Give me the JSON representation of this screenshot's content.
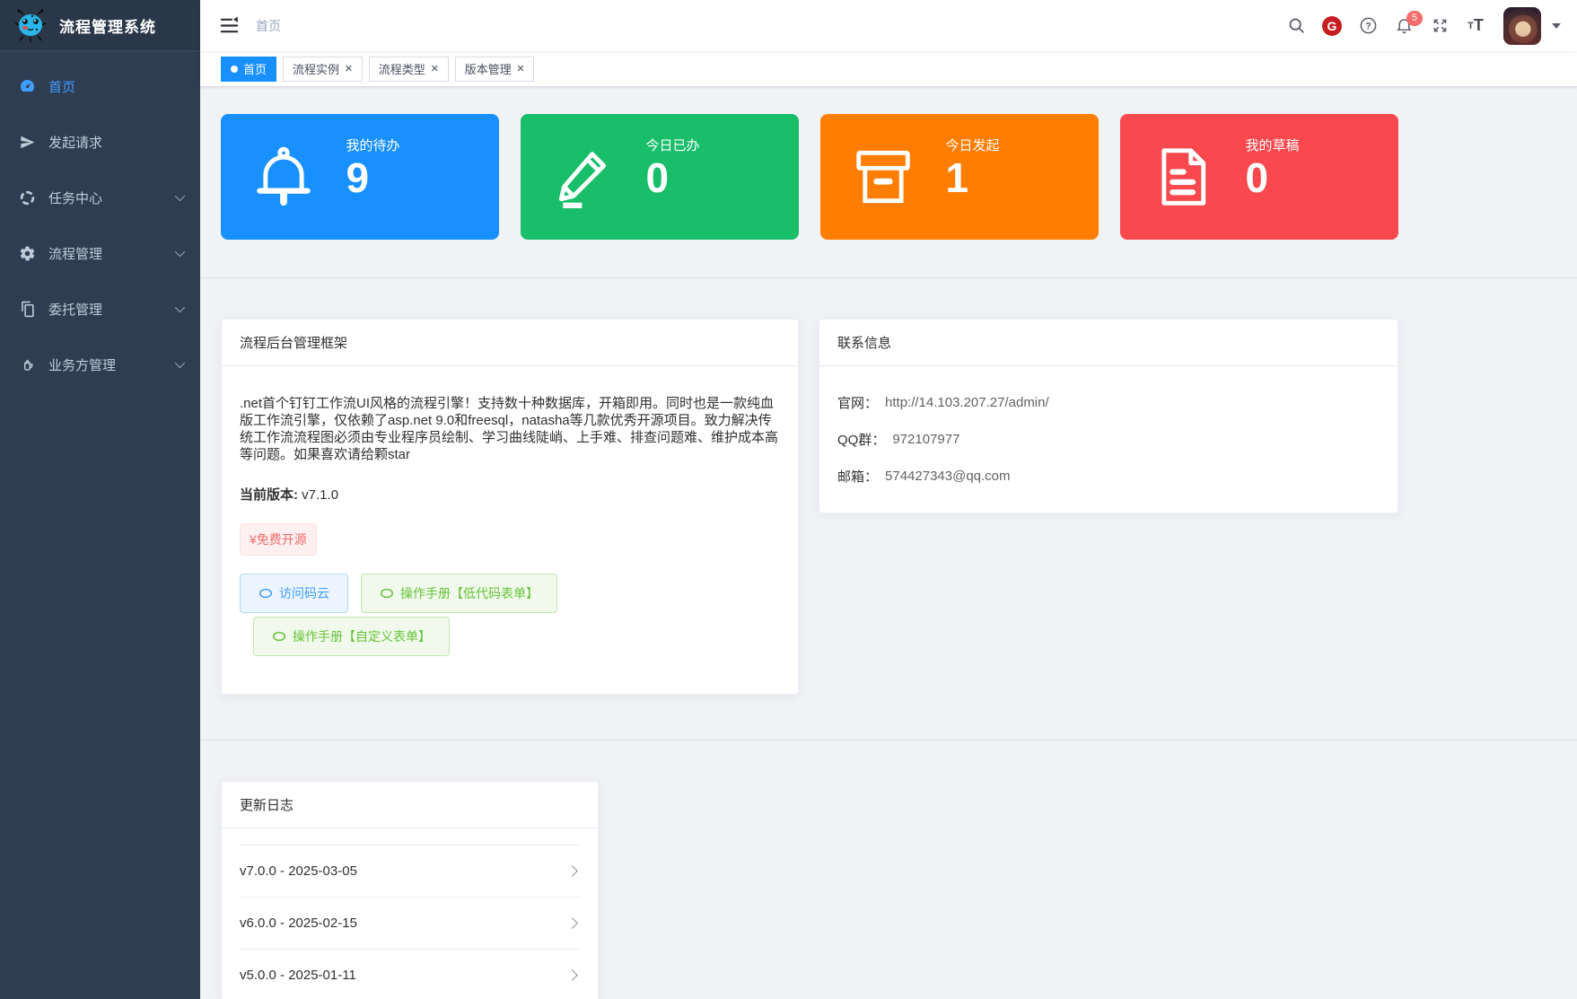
{
  "app": {
    "title": "流程管理系统",
    "logo_icon": "bug-mascot-icon"
  },
  "colors": {
    "primary": "#1890ff",
    "sidebar_bg": "#2f3d52",
    "danger_badge": "#f56c6c",
    "gitee_red": "#c71d23"
  },
  "sidebar": {
    "items": [
      {
        "label": "首页",
        "icon": "dashboard-icon",
        "active": true,
        "has_children": false
      },
      {
        "label": "发起请求",
        "icon": "send-icon",
        "active": false,
        "has_children": false
      },
      {
        "label": "任务中心",
        "icon": "task-ring-icon",
        "active": false,
        "has_children": true
      },
      {
        "label": "流程管理",
        "icon": "gear-icon",
        "active": false,
        "has_children": true
      },
      {
        "label": "委托管理",
        "icon": "copy-icon",
        "active": false,
        "has_children": true
      },
      {
        "label": "业务方管理",
        "icon": "teapot-icon",
        "active": false,
        "has_children": true
      }
    ]
  },
  "header": {
    "breadcrumb": "首页",
    "notification_count": "5",
    "icons": [
      "collapse-menu-icon",
      "search-icon",
      "gitee-icon",
      "help-icon",
      "bell-icon",
      "fullscreen-icon",
      "font-size-icon",
      "avatar",
      "caret-down-icon"
    ]
  },
  "tabs": [
    {
      "label": "首页",
      "active": true,
      "closable": false
    },
    {
      "label": "流程实例",
      "active": false,
      "closable": true
    },
    {
      "label": "流程类型",
      "active": false,
      "closable": true
    },
    {
      "label": "版本管理",
      "active": false,
      "closable": true
    }
  ],
  "stats": [
    {
      "label": "我的待办",
      "value": "9",
      "color": "#1890ff",
      "icon": "bell-outline-icon"
    },
    {
      "label": "今日已办",
      "value": "0",
      "color": "#19be6b",
      "icon": "pencil-icon"
    },
    {
      "label": "今日发起",
      "value": "1",
      "color": "#ff7d00",
      "icon": "archive-box-icon"
    },
    {
      "label": "我的草稿",
      "value": "0",
      "color": "#f9484e",
      "icon": "draft-document-icon"
    }
  ],
  "intro_card": {
    "title": "流程后台管理框架",
    "description": ".net首个钉钉工作流UI风格的流程引擎！支持数十种数据库，开箱即用。同时也是一款纯血版工作流引擎，仅依赖了asp.net 9.0和freesql，natasha等几款优秀开源项目。致力解决传统工作流流程图必须由专业程序员绘制、学习曲线陡峭、上手难、排查问题难、维护成本高等问题。如果喜欢请给颗star",
    "version_label": "当前版本:",
    "version": "v7.1.0",
    "tag": "¥免费开源",
    "buttons": [
      {
        "label": "访问码云",
        "type": "primary",
        "icon": "oval-icon"
      },
      {
        "label": "操作手册【低代码表单】",
        "type": "success",
        "icon": "oval-icon"
      },
      {
        "label": "操作手册【自定义表单】",
        "type": "success",
        "icon": "oval-icon"
      }
    ]
  },
  "contact_card": {
    "title": "联系信息",
    "rows": [
      {
        "label": "官网：",
        "value": "http://14.103.207.27/admin/"
      },
      {
        "label": "QQ群：",
        "value": "972107977"
      },
      {
        "label": "邮箱：",
        "value": "574427343@qq.com"
      }
    ]
  },
  "changelog_card": {
    "title": "更新日志",
    "items": [
      "v7.0.0 - 2025-03-05",
      "v6.0.0 - 2025-02-15",
      "v5.0.0 - 2025-01-11"
    ]
  }
}
